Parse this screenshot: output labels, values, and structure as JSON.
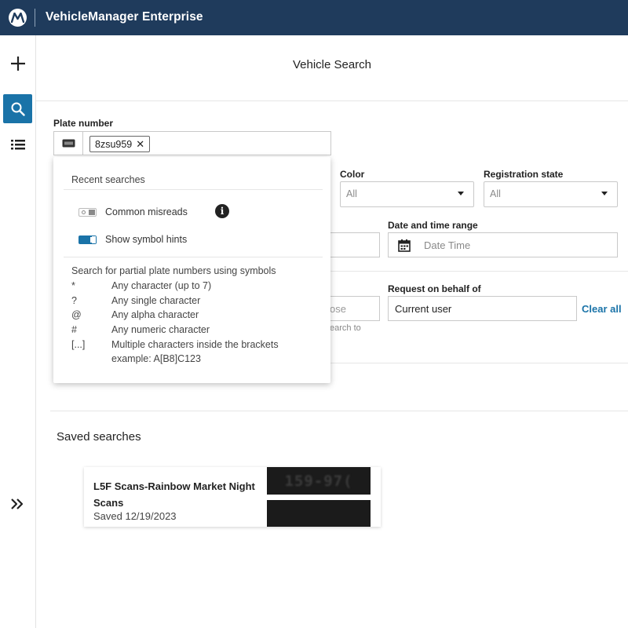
{
  "app": {
    "title": "VehicleManager Enterprise",
    "logo_icon": "motorola-logo"
  },
  "rail": {
    "items": [
      {
        "icon": "plus-icon"
      },
      {
        "icon": "search-icon",
        "active": true
      },
      {
        "icon": "list-icon"
      }
    ],
    "expand_icon": "double-chevron-right-icon"
  },
  "page": {
    "title": "Vehicle Search"
  },
  "plate": {
    "label": "Plate number",
    "chip_value": "8zsu959",
    "chip_remove": "✕"
  },
  "dropdown": {
    "recent_heading": "Recent searches",
    "toggles": [
      {
        "label": "Common misreads",
        "on": false
      },
      {
        "label": "Show symbol hints",
        "on": true
      }
    ],
    "info_glyph": "i",
    "symbols_heading": "Search for partial plate numbers using symbols",
    "symbols": [
      {
        "symbol": "*",
        "description": "Any character (up to 7)"
      },
      {
        "symbol": "?",
        "description": "Any single character"
      },
      {
        "symbol": "@",
        "description": "Any alpha character"
      },
      {
        "symbol": "#",
        "description": "Any numeric character"
      },
      {
        "symbol": "[...]",
        "description": "Multiple characters inside the brackets"
      }
    ],
    "example": "example: A[B8]C123"
  },
  "filters": {
    "color": {
      "label": "Color",
      "value": "All"
    },
    "registration_state": {
      "label": "Registration state",
      "value": "All"
    },
    "date_time": {
      "label": "Date and time range",
      "placeholder": "Date Time"
    },
    "partial_field_text": "ose",
    "partial_helper_text": "earch to",
    "request_on_behalf": {
      "label": "Request on behalf of",
      "value": "Current user"
    },
    "clear_all": "Clear all"
  },
  "saved": {
    "title": "Saved searches",
    "cards": [
      {
        "title": "L5F Scans-Rainbow Market Night Scans",
        "saved": "Saved 12/19/2023",
        "plate_image_text": "159-97("
      }
    ]
  },
  "colors": {
    "topbar": "#1f3b5c",
    "accent": "#1a73a8"
  }
}
